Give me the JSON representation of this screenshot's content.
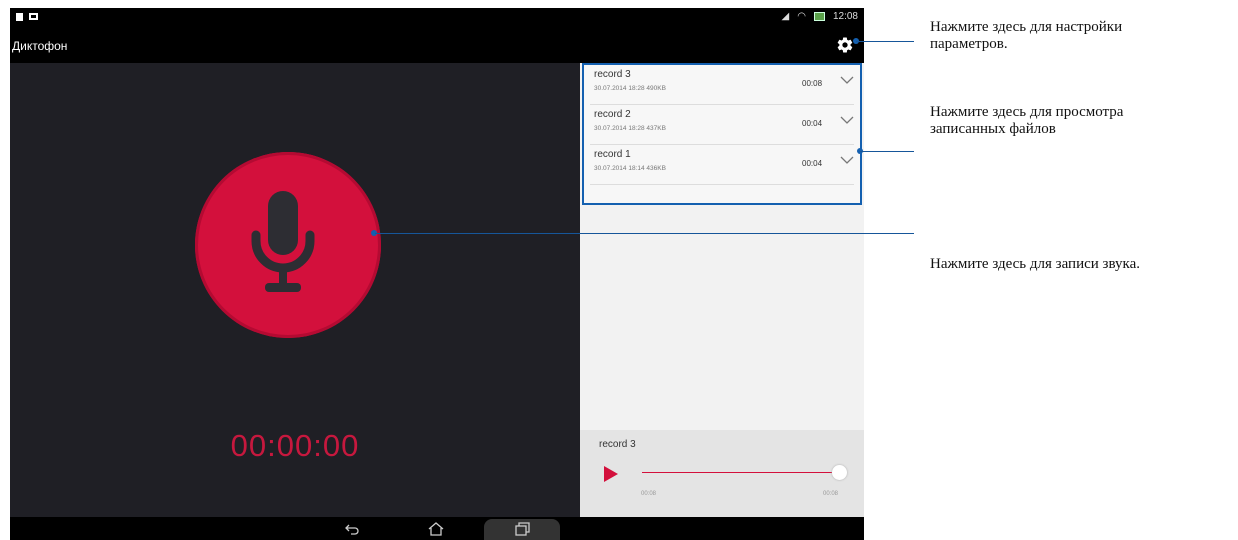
{
  "status_bar": {
    "time": "12:08"
  },
  "app": {
    "title": "Диктофон"
  },
  "recordings": [
    {
      "name": "record 3",
      "meta": "30.07.2014 18:28  490KB",
      "duration": "00:08"
    },
    {
      "name": "record 2",
      "meta": "30.07.2014 18:28  437KB",
      "duration": "00:04"
    },
    {
      "name": "record 1",
      "meta": "30.07.2014 18:14  436KB",
      "duration": "00:04"
    }
  ],
  "recorder": {
    "timer": "00:00:00"
  },
  "player": {
    "name": "record 3",
    "time_start": "00:08",
    "time_end": "00:08"
  },
  "callouts": {
    "settings_line1": "Нажмите здесь для настройки",
    "settings_line2": "параметров.",
    "files_line1": "Нажмите здесь для просмотра",
    "files_line2": "записанных файлов",
    "record": "Нажмите здесь для записи звука."
  },
  "colors": {
    "accent": "#d3103c",
    "callout": "#1460b0",
    "background": "#1f1f25"
  },
  "icons": [
    "notification-icon",
    "gallery-icon",
    "settings-gear-icon",
    "microphone-icon",
    "chevron-down-icon",
    "play-icon",
    "back-icon",
    "home-icon",
    "recent-apps-icon"
  ]
}
